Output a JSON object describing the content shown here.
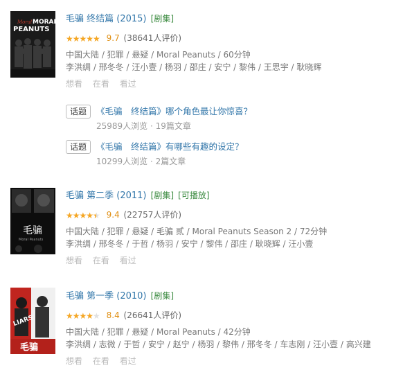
{
  "entries": [
    {
      "title": "毛骗 终结篇 (2015)",
      "tags": [
        "[剧集]"
      ],
      "rating_stars": 5,
      "score": "9.7",
      "count": "(38641人评价)",
      "meta": "中国大陆 / 犯罪 / 悬疑 / Moral Peanuts / 60分钟",
      "cast": "李洪绸 / 邢冬冬 / 汪小壹 / 杨羽 / 邵庄 / 安宁 / 黎伟 / 王思宇 / 耿晓辉",
      "actions": [
        "想看",
        "在看",
        "看过"
      ],
      "poster_text": "MORAL PEANUTS",
      "poster_script": "Moral"
    },
    {
      "title": "毛骗 第二季 (2011)",
      "tags": [
        "[剧集]",
        "[可播放]"
      ],
      "rating_stars": 4.5,
      "score": "9.4",
      "count": "(22757人评价)",
      "meta": "中国大陆 / 犯罪 / 悬疑 / 毛骗 贰 / Moral Peanuts Season 2 / 72分钟",
      "cast": "李洪绸 / 邢冬冬 / 于哲 / 杨羽 / 安宁 / 黎伟 / 邵庄 / 耿晓辉 / 汪小壹",
      "actions": [
        "想看",
        "在看",
        "看过"
      ],
      "poster_text": "毛骗",
      "poster_script": "Moral Peanuts"
    },
    {
      "title": "毛骗 第一季 (2010)",
      "tags": [
        "[剧集]"
      ],
      "rating_stars": 4,
      "score": "8.4",
      "count": "(26641人评价)",
      "meta": "中国大陆 / 犯罪 / 悬疑 / Moral Peanuts / 42分钟",
      "cast": "李洪绸 / 志微 / 于哲 / 安宁 / 赵宁 / 杨羽 / 黎伟 / 邢冬冬 / 车志刚 / 汪小壹 / 高兴建",
      "actions": [
        "想看",
        "在看",
        "看过"
      ],
      "poster_text": "毛骗",
      "poster_script": "LIARS"
    }
  ],
  "topics": [
    {
      "tag": "话题",
      "title": "《毛骗　终结篇》哪个角色最让你惊喜？",
      "stats": "25989人浏览 · 19篇文章"
    },
    {
      "tag": "话题",
      "title": "《毛骗　终结篇》有哪些有趣的设定？",
      "stats": "10299人浏览 · 2篇文章"
    }
  ],
  "colors": {
    "link": "#3377aa",
    "tag_green": "#3a8a3f",
    "star": "#f5a623",
    "score": "#e09015"
  }
}
